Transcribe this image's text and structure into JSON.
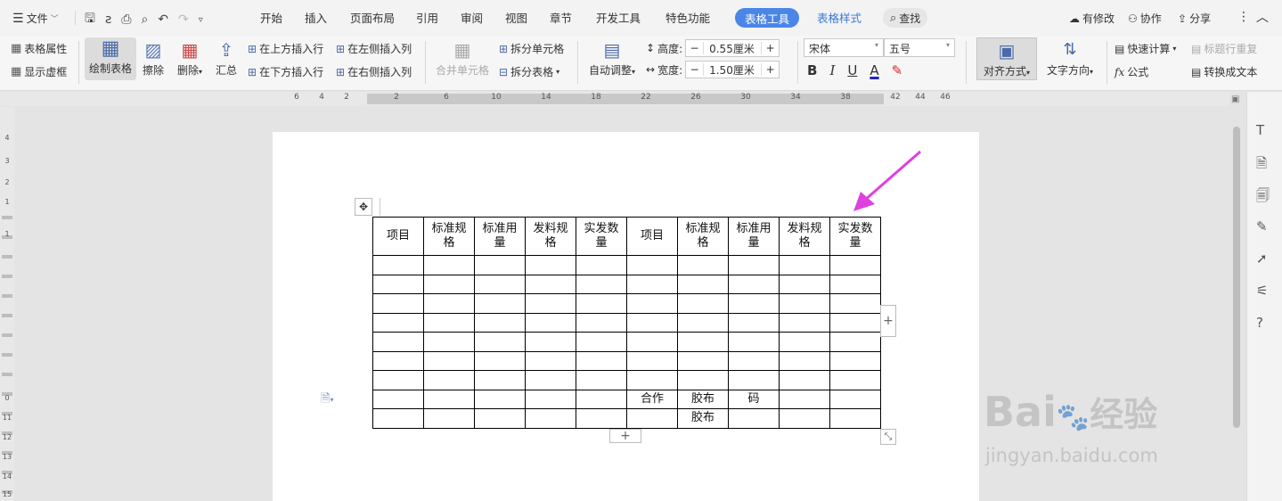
{
  "menu": {
    "file": "文件",
    "tabs": [
      "开始",
      "插入",
      "页面布局",
      "引用",
      "审阅",
      "视图",
      "章节",
      "开发工具",
      "特色功能"
    ],
    "active_tab": "表格工具",
    "table_style_tab": "表格样式",
    "search": "查找"
  },
  "topright": {
    "changes": "有修改",
    "collab": "协作",
    "share": "分享"
  },
  "ribbon": {
    "table_props": "表格属性",
    "show_grid": "显示虚框",
    "draw_table": "绘制表格",
    "erase": "擦除",
    "delete": "删除",
    "summary": "汇总",
    "insert_above": "在上方插入行",
    "insert_below": "在下方插入行",
    "insert_left": "在左侧插入列",
    "insert_right": "在右侧插入列",
    "merge": "合并单元格",
    "split_cell": "拆分单元格",
    "split_table": "拆分表格",
    "autofit": "自动调整",
    "height_label": "高度:",
    "height_value": "0.55厘米",
    "width_label": "宽度:",
    "width_value": "1.50厘米",
    "font": "宋体",
    "size": "五号",
    "bold": "B",
    "italic": "I",
    "underline": "U",
    "fontcolor": "A",
    "align": "对齐方式",
    "text_dir": "文字方向",
    "quick_calc": "快速计算",
    "repeat_header": "标题行重复",
    "formula": "公式",
    "to_text": "转换成文本"
  },
  "ruler_numbers": [
    "6",
    "4",
    "2",
    "2",
    "6",
    "10",
    "14",
    "18",
    "22",
    "26",
    "30",
    "34",
    "38",
    "42",
    "44",
    "46"
  ],
  "vruler_numbers": [
    "4",
    "3",
    "2",
    "1",
    "1",
    "0",
    "11",
    "12",
    "13",
    "14",
    "15"
  ],
  "table": {
    "headers": [
      "项目",
      "标准规\n格",
      "标准用\n量",
      "发料规\n格",
      "实发数\n量",
      "项目",
      "标准规\n格",
      "标准用\n量",
      "发料规\n格",
      "实发数\n量"
    ],
    "rows": [
      [
        "",
        "",
        "",
        "",
        "",
        "",
        "",
        "",
        "",
        ""
      ],
      [
        "",
        "",
        "",
        "",
        "",
        "",
        "",
        "",
        "",
        ""
      ],
      [
        "",
        "",
        "",
        "",
        "",
        "",
        "",
        "",
        "",
        ""
      ],
      [
        "",
        "",
        "",
        "",
        "",
        "",
        "",
        "",
        "",
        ""
      ],
      [
        "",
        "",
        "",
        "",
        "",
        "",
        "",
        "",
        "",
        ""
      ],
      [
        "",
        "",
        "",
        "",
        "",
        "",
        "",
        "",
        "",
        ""
      ],
      [
        "",
        "",
        "",
        "",
        "",
        "",
        "",
        "",
        "",
        ""
      ],
      [
        "",
        "",
        "",
        "",
        "",
        "合作",
        "胶布",
        "码",
        "",
        ""
      ],
      [
        "",
        "",
        "",
        "",
        "",
        "",
        "胶布",
        "",
        "",
        ""
      ]
    ]
  },
  "controls": {
    "add_row": "+",
    "add_col": "+"
  },
  "watermark": {
    "brand": "Bai",
    "brand2": "经验",
    "url": "jingyan.baidu.com"
  },
  "colors": {
    "accent": "#4a86e8",
    "arrow": "#e040e0"
  }
}
